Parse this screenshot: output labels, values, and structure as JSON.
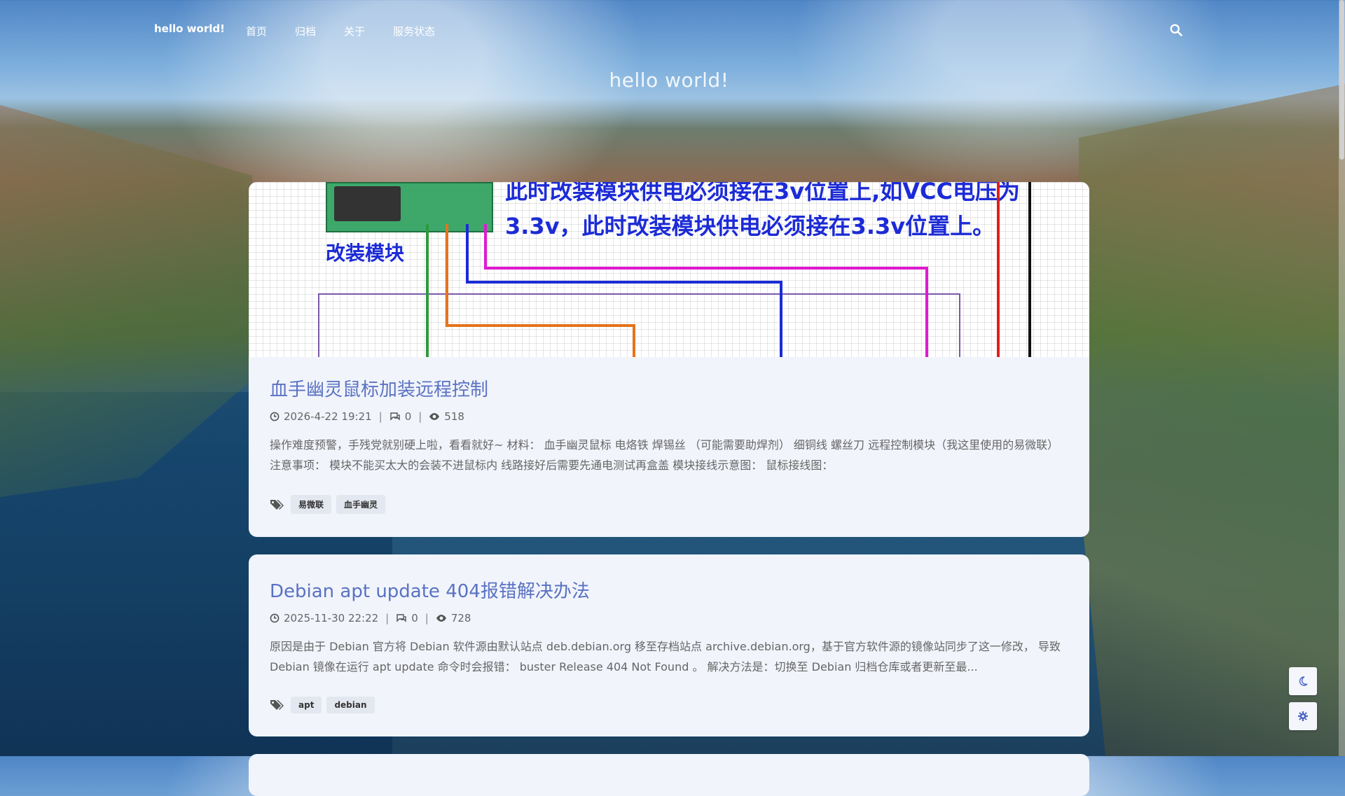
{
  "nav": {
    "brand": "hello world!",
    "items": [
      "首页",
      "归档",
      "关于",
      "服务状态"
    ]
  },
  "hero": {
    "title": "hello world!"
  },
  "posts": [
    {
      "title": "血手幽灵鼠标加装远程控制",
      "date": "2026-4-22 19:21",
      "comments": "0",
      "views": "518",
      "excerpt": "操作难度预警，手残党就别硬上啦，看看就好~ 材料：  血手幽灵鼠标 电烙铁 焊锡丝 （可能需要助焊剂） 细铜线 螺丝刀 远程控制模块（我这里使用的易微联） 注意事项：  模块不能买太大的会装不进鼠标内 线路接好后需要先通电测试再盒盖 模块接线示意图：  鼠标接线图：",
      "tags": [
        "易微联",
        "血手幽灵"
      ],
      "cover": {
        "line1": "此时改装模块供电必须接在3v位置上,如VCC电压为",
        "line2": "3.3v，此时改装模块供电必须接在3.3v位置上。",
        "label": "改装模块"
      }
    },
    {
      "title": "Debian apt update 404报错解决办法",
      "date": "2025-11-30 22:22",
      "comments": "0",
      "views": "728",
      "excerpt": "原因是由于 Debian 官方将 Debian 软件源由默认站点 deb.debian.org 移至存档站点 archive.debian.org，基于官方软件源的镜像站同步了这一修改， 导致 Debian 镜像在运行 apt update 命令时会报错：  buster Release 404 Not Found 。  解决方法是：切换至 Debian 归档仓库或者更新至最...",
      "tags": [
        "apt",
        "debian"
      ]
    }
  ],
  "colors": {
    "title": "#5a72c2",
    "card": "#f1f4fb"
  },
  "icons": [
    "search-icon",
    "clock-icon",
    "comment-icon",
    "eye-icon",
    "tags-icon",
    "moon-icon",
    "gear-icon"
  ]
}
